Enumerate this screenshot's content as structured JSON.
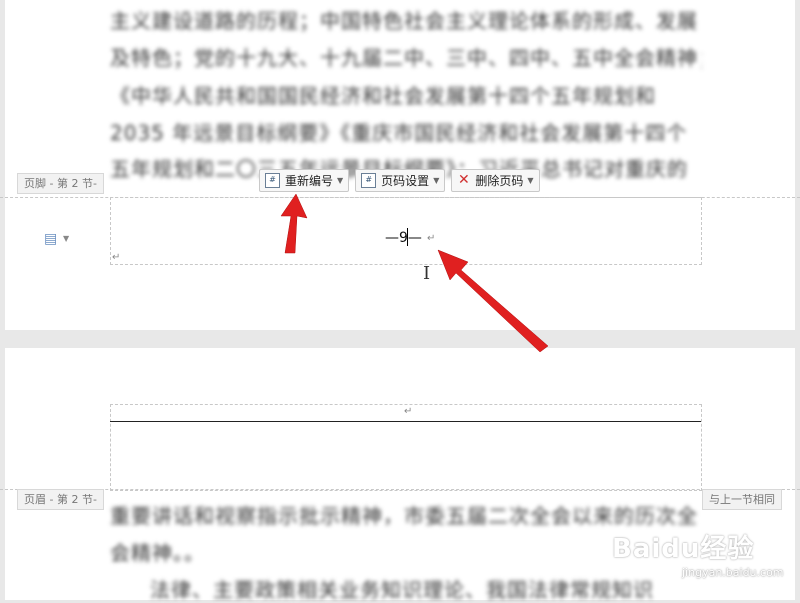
{
  "top_page": {
    "lines": [
      "主义建设道路的历程；中国特色社会主义理论体系的形成、发展",
      "及特色；党的十九大、十九届二中、三中、四中、五中全会精神；",
      "《中华人民共和国国民经济和社会发展第十四个五年规划和",
      "2035 年远景目标纲要》《重庆市国民经济和社会发展第十四个",
      "五年规划和二〇三五年远景目标纲要》；习近平总书记对重庆的"
    ],
    "right_chars": [
      "展",
      "；",
      "和",
      "个",
      "的"
    ]
  },
  "footer": {
    "section_tag": "页脚 - 第 2 节-",
    "page_number": "—9—",
    "para_mark": "↵"
  },
  "toolbar": {
    "renumber_label": "重新编号",
    "page_setup_label": "页码设置",
    "delete_label": "删除页码"
  },
  "header": {
    "section_tag": "页眉 - 第 2 节-",
    "link_label": "与上一节相同",
    "para_mark": "↵"
  },
  "bottom_page": {
    "lines": [
      "重要讲话和视察指示批示精神，市委五届二次全会以来的历次全",
      "会精神。。",
      "法律、主要政策相关业务知识理论、我国法律常规知识"
    ]
  },
  "watermark": {
    "brand": "Baidu经验",
    "url": "jingyan.baidu.com"
  },
  "colors": {
    "arrow": "#e02020",
    "page_bg": "#ffffff",
    "gap_bg": "#e8e8e8"
  }
}
